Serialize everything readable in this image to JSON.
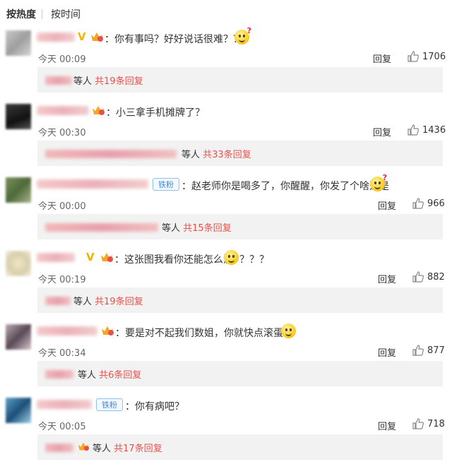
{
  "tabs": {
    "hot": "按热度",
    "time": "按时间"
  },
  "labels": {
    "reply": "回复",
    "others": "等人"
  },
  "colors": {
    "accent": "#e8504a",
    "fan_badge": "#3a8ee0"
  },
  "comments": [
    {
      "text": "：你有事吗？好好说话很难？？",
      "time": "今天 00:09",
      "likes": "1706",
      "badge": "vip",
      "crown": true,
      "fan": false,
      "emoji": "thinking",
      "reply_count": "共19条回复"
    },
    {
      "text": "：小三拿手机摊牌了？",
      "time": "今天 00:30",
      "likes": "1436",
      "badge": "none",
      "crown": true,
      "fan": false,
      "emoji": "none",
      "reply_count": "共33条回复"
    },
    {
      "fan_label": "铁粉",
      "text": "：赵老师你是喝多了，你醒醒，你发了个啥这是",
      "time": "今天 00:00",
      "likes": "966",
      "badge": "none",
      "crown": false,
      "fan": true,
      "emoji": "thinking",
      "reply_count": "共15条回复"
    },
    {
      "text": "：这张图我看你还能怎么洗",
      "text2": "？？？",
      "time": "今天 00:19",
      "likes": "882",
      "badge": "vip",
      "crown": true,
      "fan": false,
      "emoji": "smile",
      "reply_count": "共19条回复"
    },
    {
      "text": "：要是对不起我们数姐，你就快点滚蛋吧",
      "time": "今天 00:34",
      "likes": "877",
      "badge": "none",
      "crown": true,
      "fan": false,
      "emoji": "smile",
      "reply_count": "共6条回复"
    },
    {
      "fan_label": "铁粉",
      "text": "：你有病吧？",
      "time": "今天 00:05",
      "likes": "718",
      "badge": "none",
      "crown": false,
      "fan": true,
      "emoji": "none",
      "reply_count": "共17条回复"
    }
  ]
}
